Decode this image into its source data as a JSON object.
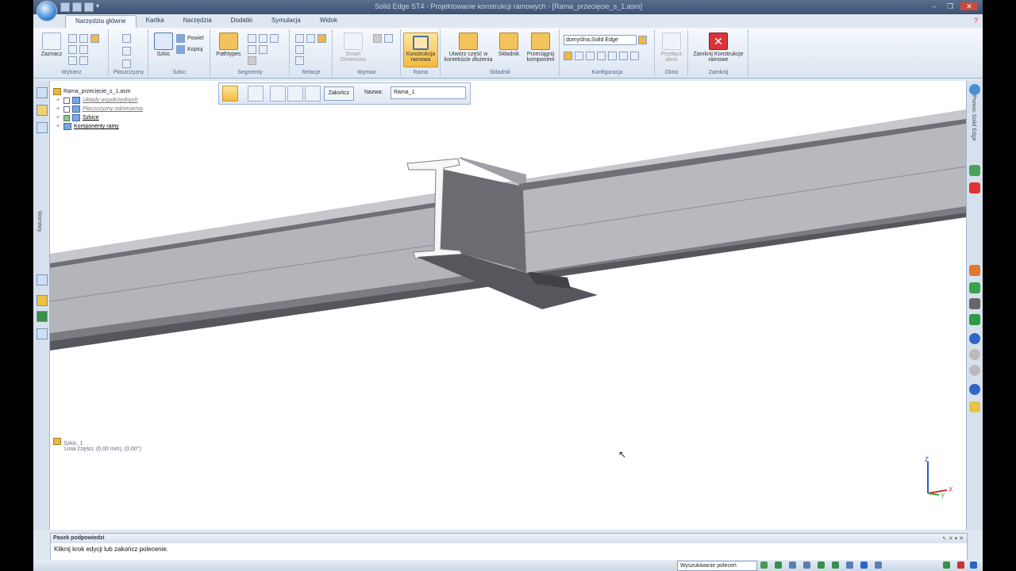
{
  "titlebar": {
    "title": "Solid Edge ST4 - Projektowanie konstrukcji ramowych - [Rama_przecięcie_s_1.asm]",
    "qat_extra": "▾"
  },
  "window_controls": {
    "minimize": "–",
    "maximize": "❐",
    "close": "✕"
  },
  "tabs": [
    "Narzędzia główne",
    "Kartka",
    "Narzędzia",
    "Dodatki",
    "Symulacja",
    "Widok"
  ],
  "ribbon": {
    "wybierz": {
      "label": "Wybierz",
      "btn": "Zaznacz"
    },
    "plaszczyzny": {
      "label": "Płaszczyzny"
    },
    "szkic": {
      "label": "Szkic",
      "btn": "Szkic",
      "s1": "Powiel",
      "s2": "Kopiuj"
    },
    "segmenty": {
      "label": "Segmenty",
      "btn": "Pathtypes"
    },
    "relacje": {
      "label": "Relacje"
    },
    "wymiar": {
      "label": "Wymiar",
      "btn": "Smart Dimension"
    },
    "rama": {
      "label": "Rama",
      "btn": "Konstrukcja ramowa"
    },
    "skladnik": {
      "label": "Składnik",
      "b1": "Utwórz część w kontekście złożenia",
      "b2": "Składnik",
      "b3": "Przeciągnij komponent"
    },
    "konfiguracja": {
      "label": "Konfiguracja",
      "combo": "domyślna,Solid Edge"
    },
    "okno": {
      "label": "Okno",
      "btn": "Przełącz okno"
    },
    "zamknij": {
      "label": "Zamknij",
      "btn": "Zamknij Konstrukcje ramowe"
    }
  },
  "leftbar": {
    "vertical": "Warstwy"
  },
  "rightbar": {
    "vertical": "Pomoc Solid Edge"
  },
  "cmdbar": {
    "finish": "Zakończ",
    "name_label": "Nazwa:",
    "name_value": "Rama_1"
  },
  "tree": {
    "root": "Rama_przecięcie_s_1.asm",
    "items": [
      "Układy współrzędnych",
      "Płaszczyzny odniesienia",
      "Szkice",
      "Komponenty ramy"
    ]
  },
  "sketch_labels": {
    "l1": "Szkic_1",
    "l2": "Linia części: (0.00 mm), (0.00°)"
  },
  "triad": {
    "z": "Z",
    "x": "X",
    "y": "Y"
  },
  "prompt": {
    "title": "Pasek podpowiedzi",
    "text": "Kliknij krok edycji lub zakończ polecenie."
  },
  "status": {
    "search": "Wyszukiwanie poleceń"
  },
  "colors": {
    "accent": "#f4b942",
    "frame": "#dfe7f1",
    "beam_top": "#b0b2b8",
    "beam_web": "#a7a9af",
    "beam_dark": "#5c5e64"
  }
}
